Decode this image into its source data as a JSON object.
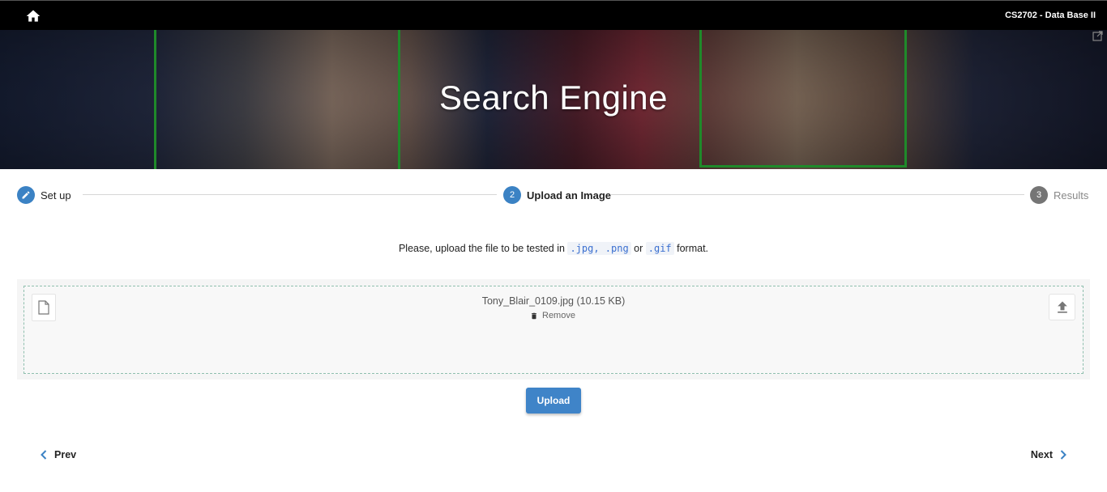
{
  "topbar": {
    "home_icon": "home-icon",
    "app_title": "CS2702 - Data Base II"
  },
  "hero": {
    "title": "Search Engine",
    "corner_icon": "external-link-icon"
  },
  "stepper": {
    "steps": [
      {
        "number": "",
        "label": "Set up",
        "state": "done",
        "icon": "pencil-icon",
        "color": "#3b82c4"
      },
      {
        "number": "2",
        "label": "Upload an Image",
        "state": "active",
        "color": "#3b82c4"
      },
      {
        "number": "3",
        "label": "Results",
        "state": "pending",
        "color": "#757575"
      }
    ]
  },
  "instructions": {
    "before": "Please, upload the file to be tested in ",
    "format_1": ".jpg, .png",
    "or": " or ",
    "format_2": ".gif",
    "after": " format."
  },
  "dropzone": {
    "file_icon": "file-icon",
    "file_name": "Tony_Blair_0109.jpg (10.15 KB)",
    "remove_label": "Remove",
    "remove_icon": "trash-icon",
    "upload_icon": "upload-icon"
  },
  "actions": {
    "upload_label": "Upload",
    "upload_color": "#3f84c8"
  },
  "navigation": {
    "prev_label": "Prev",
    "next_label": "Next",
    "chevron_color": "#3b82c4"
  }
}
